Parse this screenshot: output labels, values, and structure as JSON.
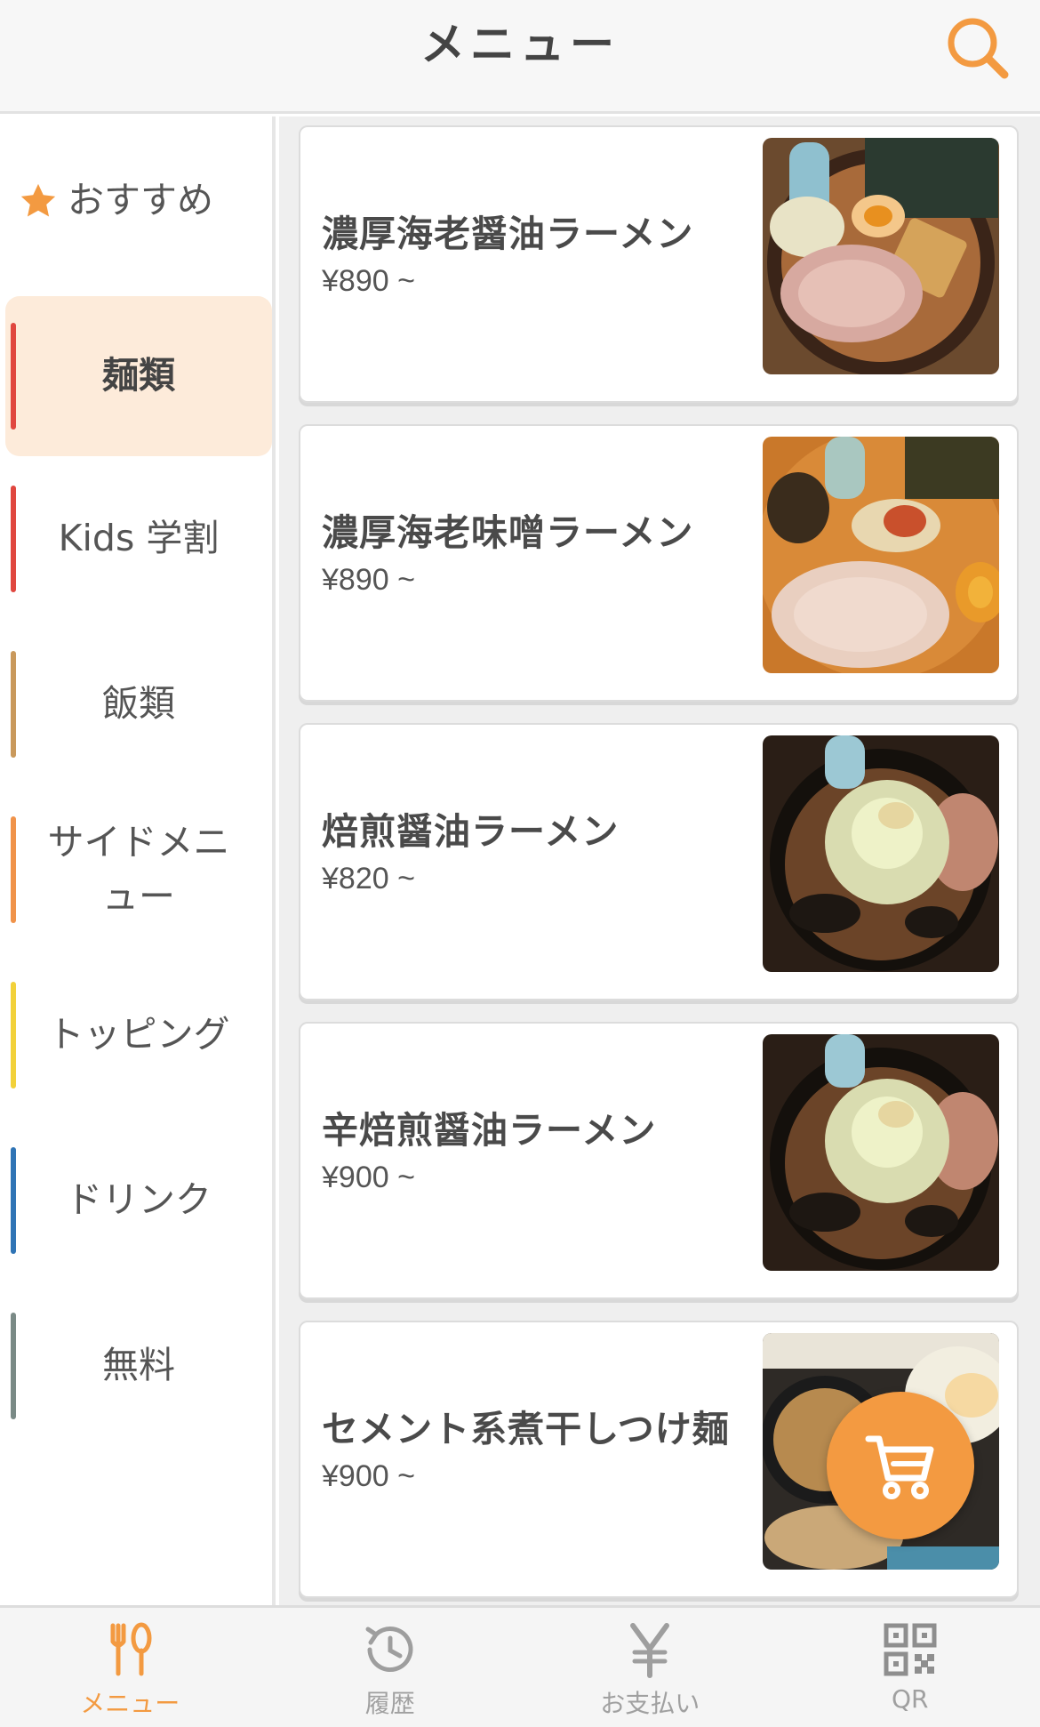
{
  "header": {
    "title": "メニュー",
    "search_icon": "search-icon"
  },
  "sidebar": {
    "items": [
      {
        "label": "おすすめ",
        "icon": "star-icon",
        "accent": "#f39a41"
      },
      {
        "label": "麺類",
        "accent": "#e0473f",
        "active": true
      },
      {
        "label": "Kids 学割",
        "accent": "#e0473f"
      },
      {
        "label": "飯類",
        "accent": "#c9995c"
      },
      {
        "label": "サイドメニュー",
        "accent": "#f0934a"
      },
      {
        "label": "トッピング",
        "accent": "#f2d13a"
      },
      {
        "label": "ドリンク",
        "accent": "#2f74b5"
      },
      {
        "label": "無料",
        "accent": "#7a8a86"
      }
    ]
  },
  "menu_items": [
    {
      "name": "濃厚海老醤油ラーメン",
      "price": "¥890 ~"
    },
    {
      "name": "濃厚海老味噌ラーメン",
      "price": "¥890 ~"
    },
    {
      "name": "焙煎醤油ラーメン",
      "price": "¥820 ~"
    },
    {
      "name": "辛焙煎醤油ラーメン",
      "price": "¥900 ~"
    },
    {
      "name": "セメント系煮干しつけ麺",
      "price": "¥900 ~"
    }
  ],
  "cart": {
    "icon": "cart-icon",
    "color": "#f39a41"
  },
  "bottom_nav": [
    {
      "label": "メニュー",
      "icon": "fork-knife-icon",
      "active": true
    },
    {
      "label": "履歴",
      "icon": "history-icon"
    },
    {
      "label": "お支払い",
      "icon": "yen-icon"
    },
    {
      "label": "QR",
      "icon": "qr-code-icon"
    }
  ],
  "colors": {
    "accent": "#f39a41",
    "active_bg": "#fdebda"
  }
}
